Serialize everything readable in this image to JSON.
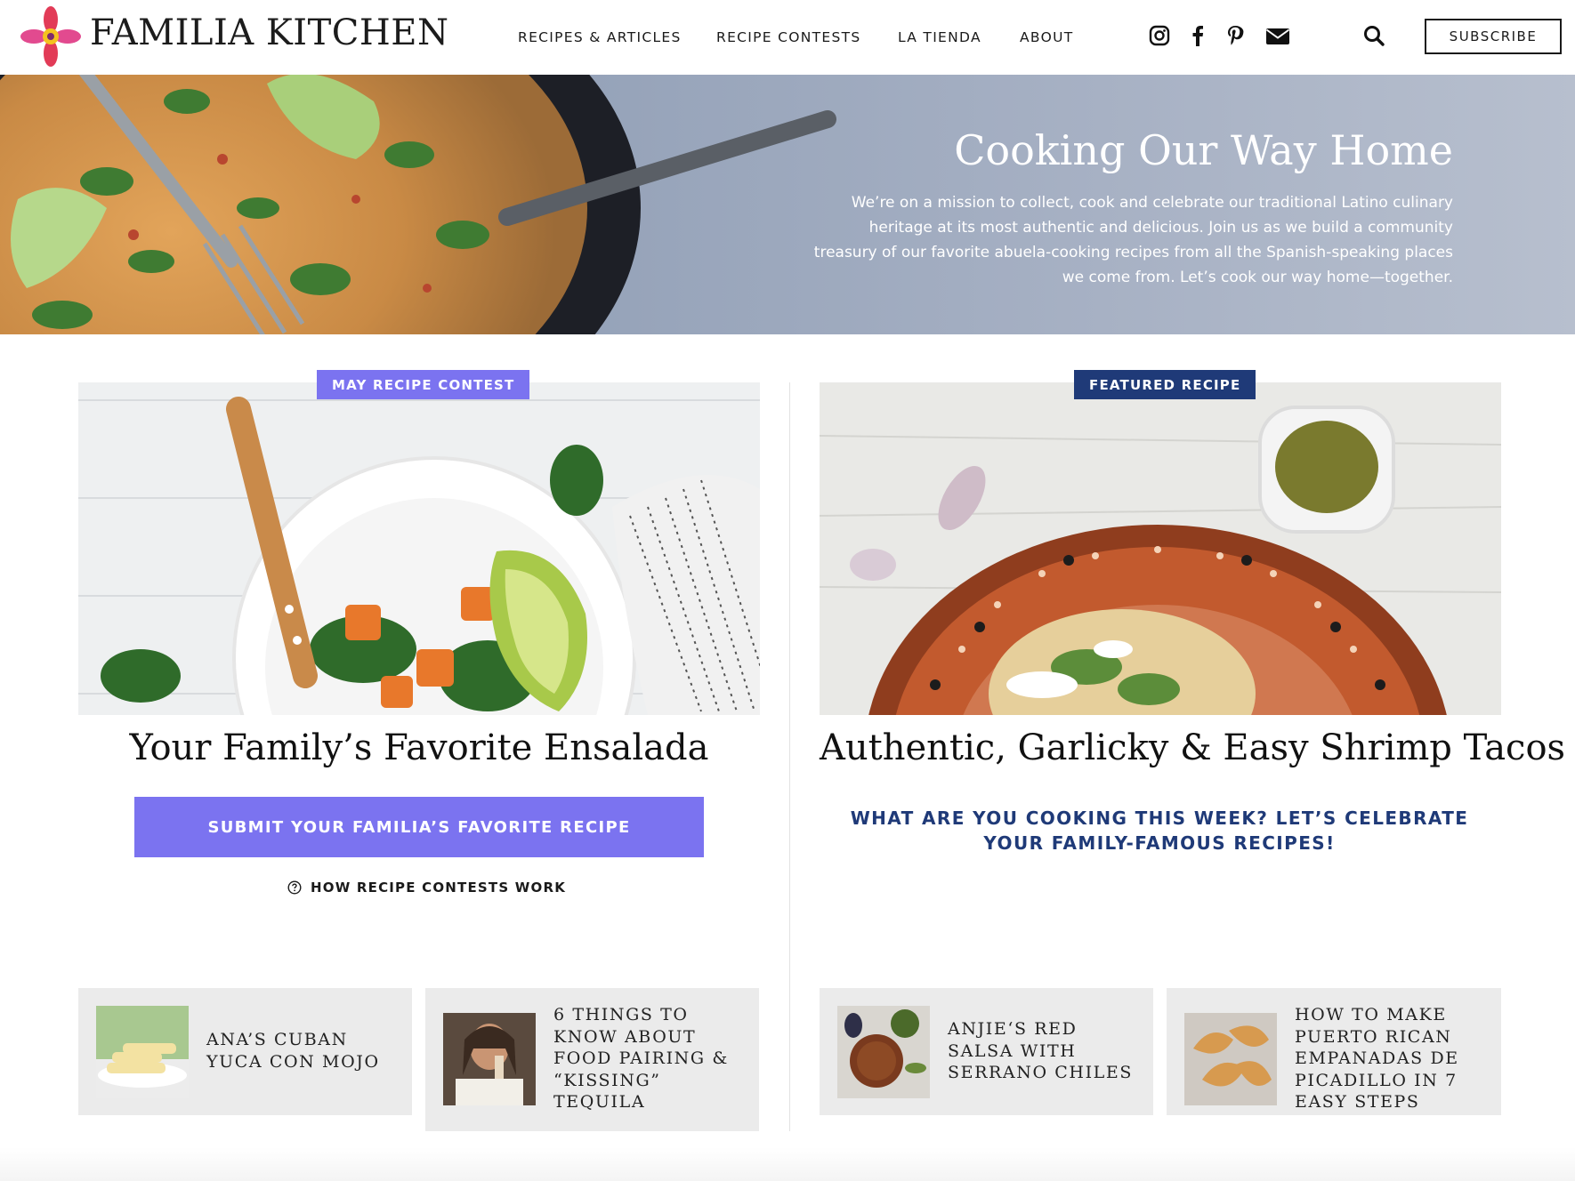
{
  "header": {
    "brand": "FAMILIA KITCHEN",
    "nav": [
      "RECIPES & ARTICLES",
      "RECIPE CONTESTS",
      "LA TIENDA",
      "ABOUT"
    ],
    "social_icons": [
      "instagram-icon",
      "facebook-icon",
      "pinterest-icon",
      "envelope-icon"
    ],
    "search_icon": "search-icon",
    "subscribe_label": "SUBSCRIBE"
  },
  "hero": {
    "title": "Cooking Our Way Home",
    "text": "We’re on a mission to collect, cook and celebrate our traditional Latino culinary heritage at its most authentic and delicious. Join us as we build a community treasury of our favorite abuela-cooking recipes from all the Spanish-speaking places we come from. Let’s cook our way home—together."
  },
  "contest": {
    "tag": "MAY RECIPE CONTEST",
    "title": "Your Family’s Favorite Ensalada",
    "cta_label": "SUBMIT YOUR FAMILIA’S FAVORITE RECIPE",
    "howto_label": "HOW RECIPE CONTESTS WORK"
  },
  "featured": {
    "tag": "FEATURED RECIPE",
    "title": "Authentic, Garlicky & Easy Shrimp Tacos",
    "message": "WHAT ARE YOU COOKING THIS WEEK? LET’S CELEBRATE YOUR FAMILY-FAMOUS RECIPES!"
  },
  "articles": [
    {
      "title": "ANA’S CUBAN YUCA CON MOJO"
    },
    {
      "title": "6 THINGS TO KNOW ABOUT FOOD PAIRING & “KISSING” TEQUILA"
    },
    {
      "title": "ANJIE‘S RED SALSA WITH SERRANO CHILES"
    },
    {
      "title": "HOW TO MAKE PUERTO RICAN EMPANADAS DE PICADILLO IN 7 EASY STEPS"
    }
  ],
  "colors": {
    "contest_tag": "#7b73f0",
    "featured_tag": "#1f3a78",
    "cta": "#7b73f0",
    "accent_blue": "#1f3a78",
    "card_bg": "#ebebeb"
  }
}
